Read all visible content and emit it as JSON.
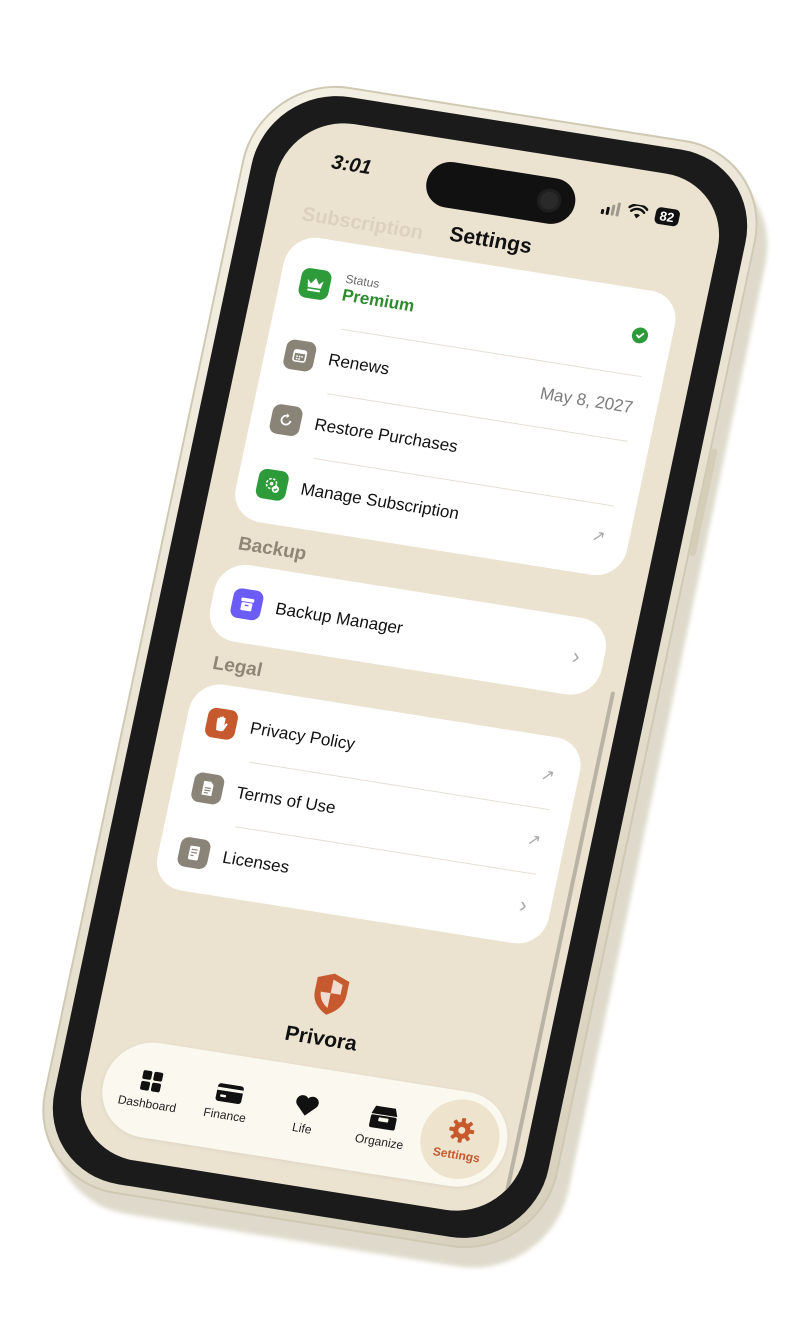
{
  "status_bar": {
    "time": "3:01",
    "battery": "82"
  },
  "nav": {
    "title": "Settings",
    "ghost_header": "Subscription"
  },
  "subscription": {
    "status_caption": "Status",
    "status_value": "Premium",
    "renews_label": "Renews",
    "renews_value": "May 8, 2027",
    "restore_label": "Restore Purchases",
    "manage_label": "Manage Subscription"
  },
  "backup": {
    "header": "Backup",
    "manager_label": "Backup Manager"
  },
  "legal": {
    "header": "Legal",
    "items": [
      {
        "label": "Privacy Policy"
      },
      {
        "label": "Terms of Use"
      },
      {
        "label": "Licenses"
      }
    ]
  },
  "brand": {
    "name": "Privora"
  },
  "tabs": [
    {
      "label": "Dashboard",
      "icon": "grid-icon"
    },
    {
      "label": "Finance",
      "icon": "card-icon"
    },
    {
      "label": "Life",
      "icon": "heart-icon"
    },
    {
      "label": "Organize",
      "icon": "box-icon"
    },
    {
      "label": "Settings",
      "icon": "gear-icon",
      "active": true
    }
  ],
  "colors": {
    "background": "#ebe2d0",
    "premium_green": "#2e8b2e",
    "accent_orange": "#c65a2e",
    "backup_purple": "#6b5cf5",
    "icon_gray": "#8a8377"
  }
}
